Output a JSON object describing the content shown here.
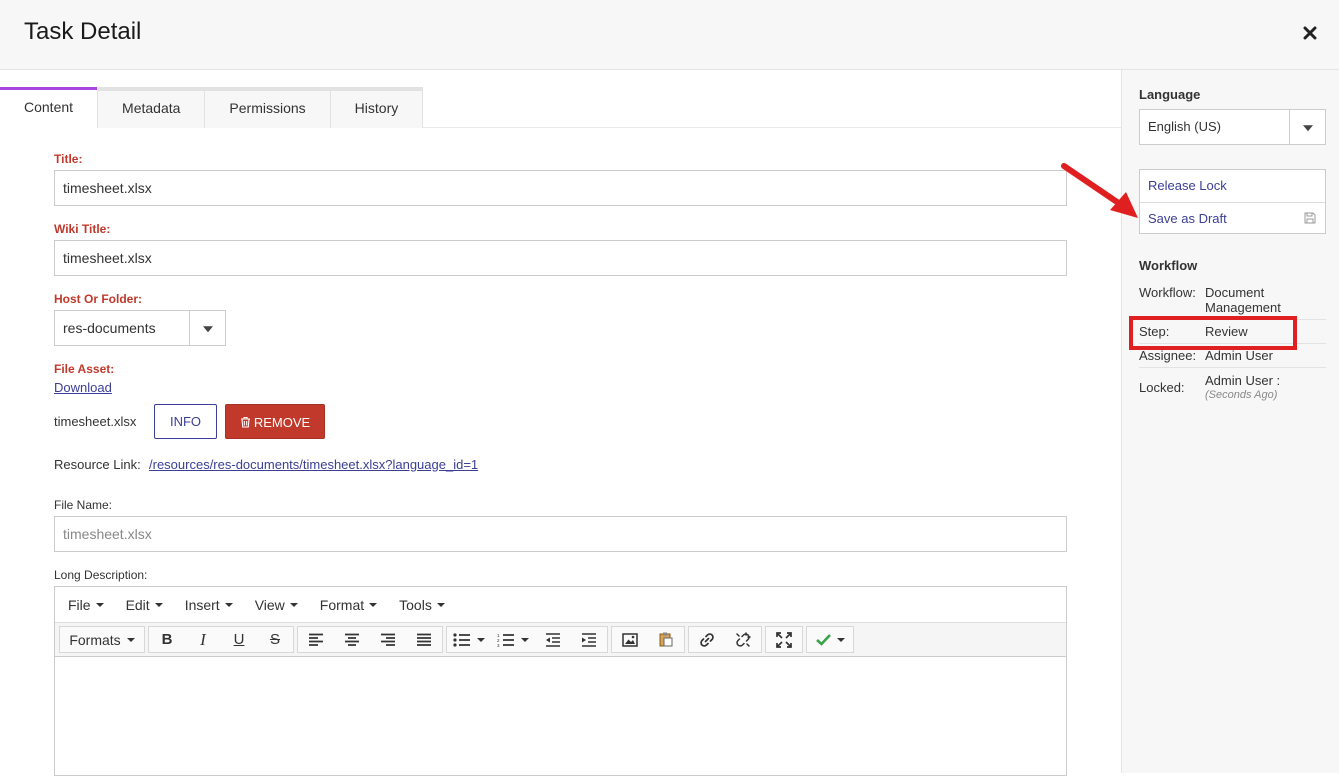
{
  "header": {
    "title": "Task Detail"
  },
  "tabs": [
    {
      "label": "Content",
      "active": true
    },
    {
      "label": "Metadata",
      "active": false
    },
    {
      "label": "Permissions",
      "active": false
    },
    {
      "label": "History",
      "active": false
    }
  ],
  "form": {
    "title_label": "Title:",
    "title_value": "timesheet.xlsx",
    "wiki_title_label": "Wiki Title:",
    "wiki_title_value": "timesheet.xlsx",
    "host_label": "Host Or Folder:",
    "host_value": "res-documents",
    "file_asset_label": "File Asset:",
    "download_link": "Download",
    "file_name_text": "timesheet.xlsx",
    "info_button": "INFO",
    "remove_button": "REMOVE",
    "resource_link_label": "Resource Link:",
    "resource_link": "/resources/res-documents/timesheet.xlsx?language_id=1",
    "file_name_label": "File Name:",
    "file_name_placeholder": "timesheet.xlsx",
    "long_desc_label": "Long Description:"
  },
  "editor": {
    "menus": [
      "File",
      "Edit",
      "Insert",
      "View",
      "Format",
      "Tools"
    ],
    "formats_label": "Formats"
  },
  "sidebar": {
    "language_heading": "Language",
    "language_value": "English (US)",
    "release_lock": "Release Lock",
    "save_draft": "Save as Draft",
    "workflow_heading": "Workflow",
    "workflow": {
      "workflow_key": "Workflow:",
      "workflow_value": "Document Management",
      "step_key": "Step:",
      "step_value": "Review",
      "assignee_key": "Assignee:",
      "assignee_value": "Admin User",
      "locked_key": "Locked:",
      "locked_value": "Admin User :",
      "locked_time": "(Seconds Ago)"
    }
  },
  "colors": {
    "accent_tab": "#a448e0",
    "required_label": "#c0392b",
    "link": "#3b3f95",
    "remove_button": "#c1392b",
    "annotation": "#e02020"
  }
}
